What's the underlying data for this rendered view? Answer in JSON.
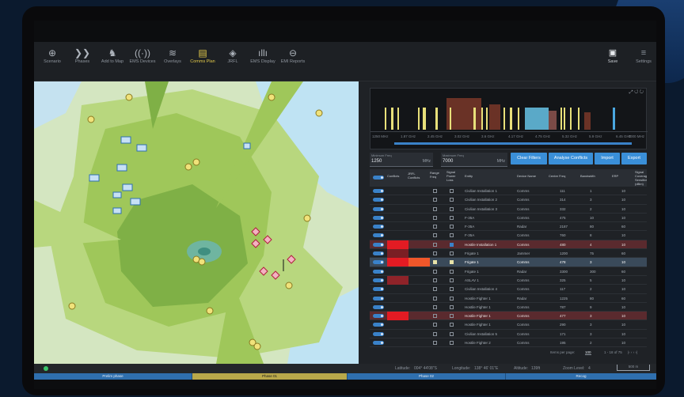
{
  "toolbar": {
    "items": [
      {
        "label": "Scenario",
        "icon": "globe-icon",
        "glyph": "⊕"
      },
      {
        "label": "Phases",
        "icon": "chevrons-icon",
        "glyph": "❯❯"
      },
      {
        "label": "Add to Map",
        "icon": "units-icon",
        "glyph": "♞"
      },
      {
        "label": "EMS Devices",
        "icon": "antenna-icon",
        "glyph": "((·))"
      },
      {
        "label": "Overlays",
        "icon": "layers-icon",
        "glyph": "≋"
      },
      {
        "label": "Comms Plan",
        "icon": "comms-plan-icon",
        "glyph": "▤"
      },
      {
        "label": "JRFL",
        "icon": "jrfl-icon",
        "glyph": "◈"
      },
      {
        "label": "EMS Display",
        "icon": "spectrum-icon",
        "glyph": "ıllı"
      },
      {
        "label": "EMI Reports",
        "icon": "report-icon",
        "glyph": "⊖"
      }
    ],
    "active_index": 5,
    "save_label": "Save",
    "settings_label": "Settings"
  },
  "spectrum": {
    "min_label": "1250 MHz",
    "max_label": "7000 MHz",
    "ticks": [
      "1.87 GHz",
      "2.45 GHz",
      "3.02 GHz",
      "3.6 GHz",
      "4.17 GHz",
      "4.75 GHz",
      "5.32 GHz",
      "5.9 GHz",
      "6.45 GHz"
    ]
  },
  "filters": {
    "min_label": "Minimum Freq",
    "min_value": "1250",
    "min_unit": "MHz",
    "max_label": "Maximum Freq",
    "max_value": "7000",
    "max_unit": "MHz",
    "clear": "Clear Filters",
    "analyse": "Analyse Conflicts",
    "import": "Import",
    "export": "Export"
  },
  "columns": {
    "conflicts": "Conflicts",
    "jrfl": "JRFL Conflicts",
    "range": "Range Freq",
    "signal": "Signal Power Loss",
    "entity": "Entity",
    "device": "Device Name",
    "centre": "Centre Freq",
    "bandwidth": "Bandwidth",
    "erp": "ERP",
    "sens": "Signal Coverage Sensitivity (dBm)"
  },
  "rows": [
    {
      "entity": "Civilian Installation 1",
      "device": "Comms",
      "freq": "111",
      "bw": "1",
      "erp": "10"
    },
    {
      "entity": "Civilian Installation 2",
      "device": "Comms",
      "freq": "314",
      "bw": "3",
      "erp": "10"
    },
    {
      "entity": "Civilian Installation 3",
      "device": "Comms",
      "freq": "332",
      "bw": "2",
      "erp": "10"
    },
    {
      "entity": "F-35A",
      "device": "Comms",
      "freq": "475",
      "bw": "10",
      "erp": "10"
    },
    {
      "entity": "F-35A",
      "device": "Radar",
      "freq": "2187",
      "bw": "80",
      "erp": "60"
    },
    {
      "entity": "F-35A",
      "device": "Comms",
      "freq": "760",
      "bw": "8",
      "erp": "10"
    },
    {
      "entity": "Hostile Installation 1",
      "device": "Comms",
      "freq": "480",
      "bw": "4",
      "erp": "10",
      "state": "hl",
      "signal": "chk",
      "conf": "red"
    },
    {
      "entity": "Frigate 1",
      "device": "Jammer",
      "freq": "1200",
      "bw": "75",
      "erp": "60",
      "conf": "dark"
    },
    {
      "entity": "Frigate 1",
      "device": "Comms",
      "freq": "478",
      "bw": "3",
      "erp": "10",
      "state": "sel",
      "range": "on",
      "signal": "on",
      "conf": "redorange"
    },
    {
      "entity": "Frigate 1",
      "device": "Radar",
      "freq": "3300",
      "bw": "300",
      "erp": "60"
    },
    {
      "entity": "ASLAV 1",
      "device": "Comms",
      "freq": "325",
      "bw": "5",
      "erp": "10",
      "conf": "darkred"
    },
    {
      "entity": "Civilian Installation 4",
      "device": "Comms",
      "freq": "117",
      "bw": "2",
      "erp": "10"
    },
    {
      "entity": "Hostile Fighter 1",
      "device": "Radar",
      "freq": "1225",
      "bw": "80",
      "erp": "60"
    },
    {
      "entity": "Hostile Fighter 1",
      "device": "Comms",
      "freq": "787",
      "bw": "9",
      "erp": "10"
    },
    {
      "entity": "Hostile Fighter 1",
      "device": "Comms",
      "freq": "477",
      "bw": "3",
      "erp": "10",
      "state": "hl",
      "conf": "red"
    },
    {
      "entity": "Hostile Fighter 1",
      "device": "Comms",
      "freq": "290",
      "bw": "3",
      "erp": "10"
    },
    {
      "entity": "Civilian Installation 5",
      "device": "Comms",
      "freq": "171",
      "bw": "3",
      "erp": "10"
    },
    {
      "entity": "Hostile Fighter 2",
      "device": "Comms",
      "freq": "195",
      "bw": "2",
      "erp": "10"
    }
  ],
  "pagination": {
    "items_label": "Items per page:",
    "per_page": "100",
    "range": "1 - 18 of 75",
    "controls": "|‹  ‹  ›  ›|"
  },
  "status": {
    "latitude_label": "Latitude:",
    "latitude": "004° 44'08\"S",
    "longitude_label": "Longitude:",
    "longitude": "138° 46' 01\"E",
    "altitude_label": "Altitude:",
    "altitude": "139ft",
    "zoom_label": "Zoom Level:",
    "zoom": "4",
    "scale": "500 m"
  },
  "phases": [
    "Prelim phase",
    "Phase 01",
    "Phase 02",
    "Recog"
  ]
}
